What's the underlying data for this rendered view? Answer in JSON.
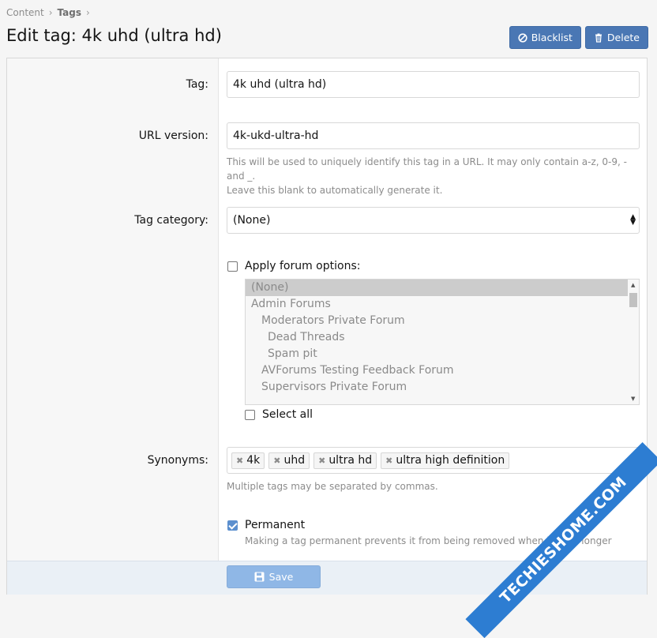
{
  "breadcrumb": {
    "items": [
      "Content",
      "Tags"
    ]
  },
  "page_title": "Edit tag: 4k uhd (ultra hd)",
  "actions": {
    "blacklist_label": "Blacklist",
    "delete_label": "Delete"
  },
  "form": {
    "tag": {
      "label": "Tag:",
      "value": "4k uhd (ultra hd)"
    },
    "url_version": {
      "label": "URL version:",
      "value": "4k-ukd-ultra-hd",
      "hint_line1": "This will be used to uniquely identify this tag in a URL. It may only contain a-z, 0-9, - and _.",
      "hint_line2": "Leave this blank to automatically generate it."
    },
    "tag_category": {
      "label": "Tag category:",
      "value": "(None)"
    },
    "forum_options": {
      "checkbox_label": "Apply forum options:",
      "checked": false,
      "items": [
        {
          "label": "(None)",
          "selected": true
        },
        {
          "label": "Admin Forums"
        },
        {
          "label": "Moderators Private Forum"
        },
        {
          "label": "Dead Threads"
        },
        {
          "label": "Spam pit"
        },
        {
          "label": "AVForums Testing Feedback Forum"
        },
        {
          "label": "Supervisors Private Forum"
        }
      ],
      "select_all_label": "Select all"
    },
    "synonyms": {
      "label": "Synonyms:",
      "tags": [
        "4k",
        "uhd",
        "ultra hd",
        "ultra high definition"
      ],
      "hint": "Multiple tags may be separated by commas."
    },
    "permanent": {
      "label": "Permanent",
      "checked": true,
      "hint": "Making a tag permanent prevents it from being removed when it is no longer"
    }
  },
  "footer": {
    "save_label": "Save"
  },
  "watermark": "TECHIESHOME.COM",
  "colors": {
    "primary_button": "#4a77b4",
    "save_button": "#8fb7e6",
    "watermark": "#2d7dd2"
  }
}
